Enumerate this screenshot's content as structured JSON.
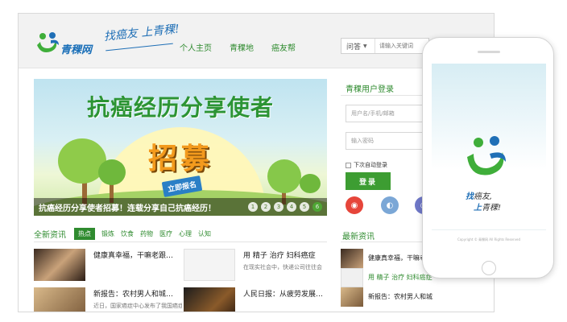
{
  "header": {
    "logo_text": "青稞网",
    "slogan": "找癌友 上青稞!",
    "nav": [
      "个人主页",
      "青稞地",
      "癌友帮"
    ],
    "search": {
      "type": "问答",
      "placeholder": "请输入关键词"
    }
  },
  "banner": {
    "title": "抗癌经历分享使者",
    "headline": "招募",
    "tag": "立即报名",
    "caption": "抗癌经历分享使者招募！连载分享自己抗癌经历！",
    "pages": [
      "1",
      "2",
      "3",
      "4",
      "5",
      "6"
    ],
    "active_page": 6
  },
  "login": {
    "title": "青稞用户登录",
    "username_placeholder": "用户名/手机/邮箱",
    "password_placeholder": "输入密码",
    "auto_login": "下次自动登录",
    "button": "登录"
  },
  "news": {
    "title": "全新资讯",
    "tabs": [
      "热点",
      "锻炼",
      "饮食",
      "药物",
      "医疗",
      "心理",
      "认知"
    ],
    "active_tab": 0,
    "items": [
      {
        "title": "健康真幸福，干嘛老跟…",
        "sub": ""
      },
      {
        "title": "用 精子 治疗 妇科癌症",
        "sub": "在现实社会中，快递公司往往会"
      },
      {
        "title": "新报告：农村男人和城…",
        "sub": "近日，国家癌症中心发布了我国癌症"
      },
      {
        "title": "人民日报：从疲劳发展…",
        "sub": ""
      }
    ]
  },
  "latest": {
    "title": "最新资讯",
    "items": [
      "健康真幸福，干嘛老跟",
      "用 精子 治疗 妇科癌症",
      "新报告：农村男人和城市女人最危险"
    ]
  },
  "phone": {
    "line1_a": "找",
    "line1_b": "癌友,",
    "line2_a": "上",
    "line2_b": "青稞!",
    "copyright": "Copyright © 青稞网 All Rights Reserved"
  },
  "colors": {
    "brand_green": "#3d9d32",
    "brand_blue": "#1f6fb6"
  }
}
